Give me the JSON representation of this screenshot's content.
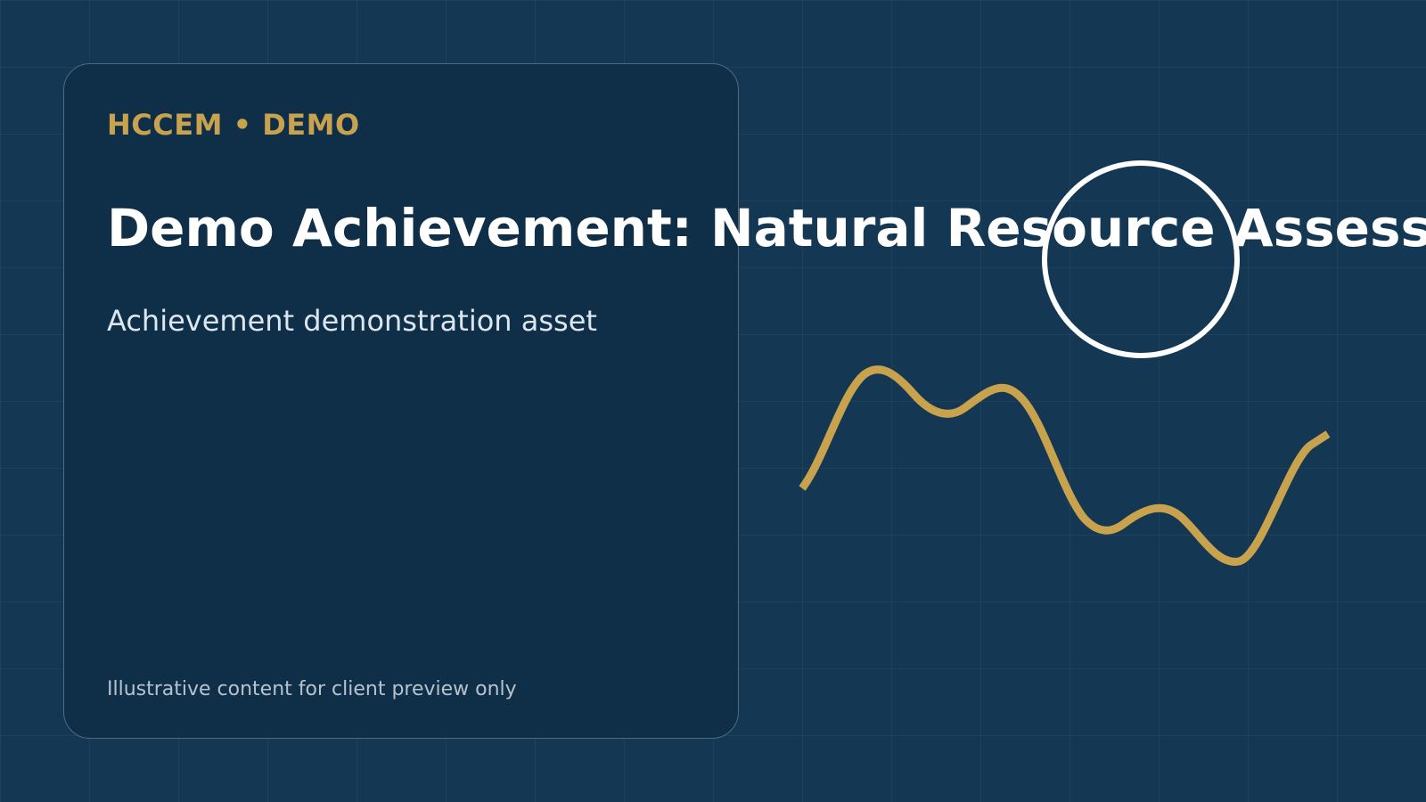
{
  "brand": {
    "eyebrow": "HCCEM • DEMO",
    "accent_color": "#c9a24d",
    "background_color": "#143853",
    "card_color": "#0f2f49"
  },
  "hero": {
    "headline": "Demo Achievement: Natural Resource Assess",
    "subtitle": "Achievement demonstration asset",
    "footnote": "Illustrative content for client preview only"
  },
  "decorations": {
    "circle_icon": "ring-outline",
    "wave_icon": "gold-wave-line"
  }
}
